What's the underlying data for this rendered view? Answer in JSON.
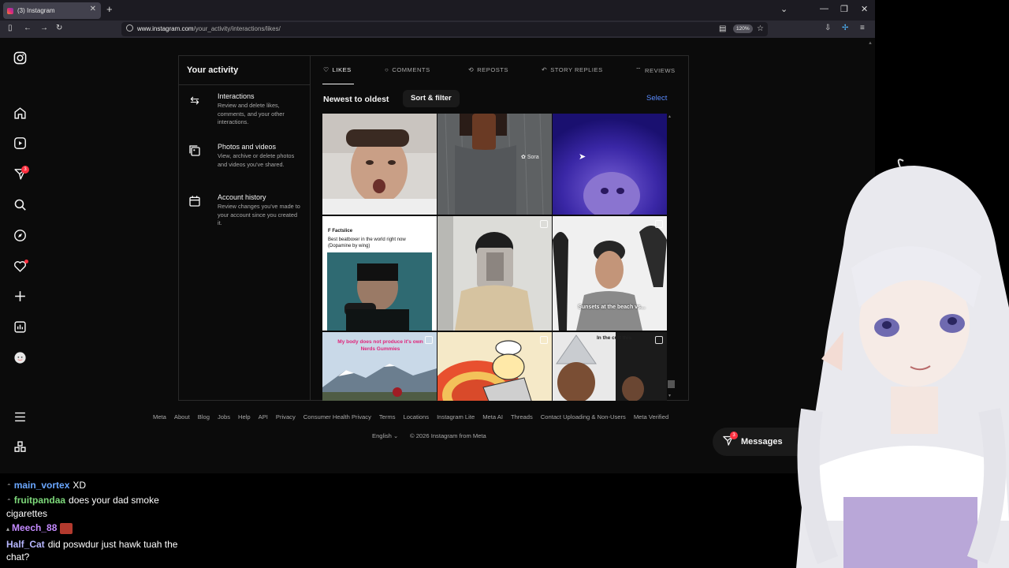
{
  "browser": {
    "tab_title": "(3) Instagram",
    "tab_close": "✕",
    "new_tab": "+",
    "url_host": "www.instagram.com",
    "url_path": "/your_activity/interactions/likes/",
    "zoom": "120%"
  },
  "rail": {
    "notification_badge": "3"
  },
  "panel": {
    "title": "Your activity",
    "menu": [
      {
        "title": "Interactions",
        "desc": "Review and delete likes, comments, and your other interactions."
      },
      {
        "title": "Photos and videos",
        "desc": "View, archive or delete photos and videos you've shared."
      },
      {
        "title": "Account history",
        "desc": "Review changes you've made to your account since you created it."
      }
    ],
    "tabs": [
      "LIKES",
      "COMMENTS",
      "REPOSTS",
      "STORY REPLIES",
      "REVIEWS"
    ],
    "sort_label": "Newest to oldest",
    "sort_button": "Sort & filter",
    "select": "Select"
  },
  "tiles": {
    "sora": "Sora",
    "t4_channel": "Factslice",
    "t4_caption": "Best beatboxer in the world right now (Dopamine by wing)",
    "t6_caption": "Sunsets at the beach vs...",
    "t7_caption": "My body does not produce it's own Nerds Gummies",
    "t9_caption": "In the cult this"
  },
  "footer": {
    "links": [
      "Meta",
      "About",
      "Blog",
      "Jobs",
      "Help",
      "API",
      "Privacy",
      "Consumer Health Privacy",
      "Terms",
      "Locations",
      "Instagram Lite",
      "Meta AI",
      "Threads",
      "Contact Uploading & Non-Users",
      "Meta Verified"
    ],
    "language": "English",
    "copyright": "© 2026 Instagram from Meta"
  },
  "messages": {
    "label": "Messages",
    "badge": "3"
  },
  "chat": [
    {
      "user": "main_vortex",
      "text": "XD",
      "color": "#6aa7ff"
    },
    {
      "user": "fruitpandaa",
      "text": "does your dad smoke cigarettes",
      "color": "#7dd87a"
    },
    {
      "user": "Meech_88",
      "text": "",
      "color": "#c48aff"
    },
    {
      "user": "Half_Cat",
      "text": "did poswdur just hawk tuah the chat?",
      "color": "#b7b7ff"
    }
  ]
}
